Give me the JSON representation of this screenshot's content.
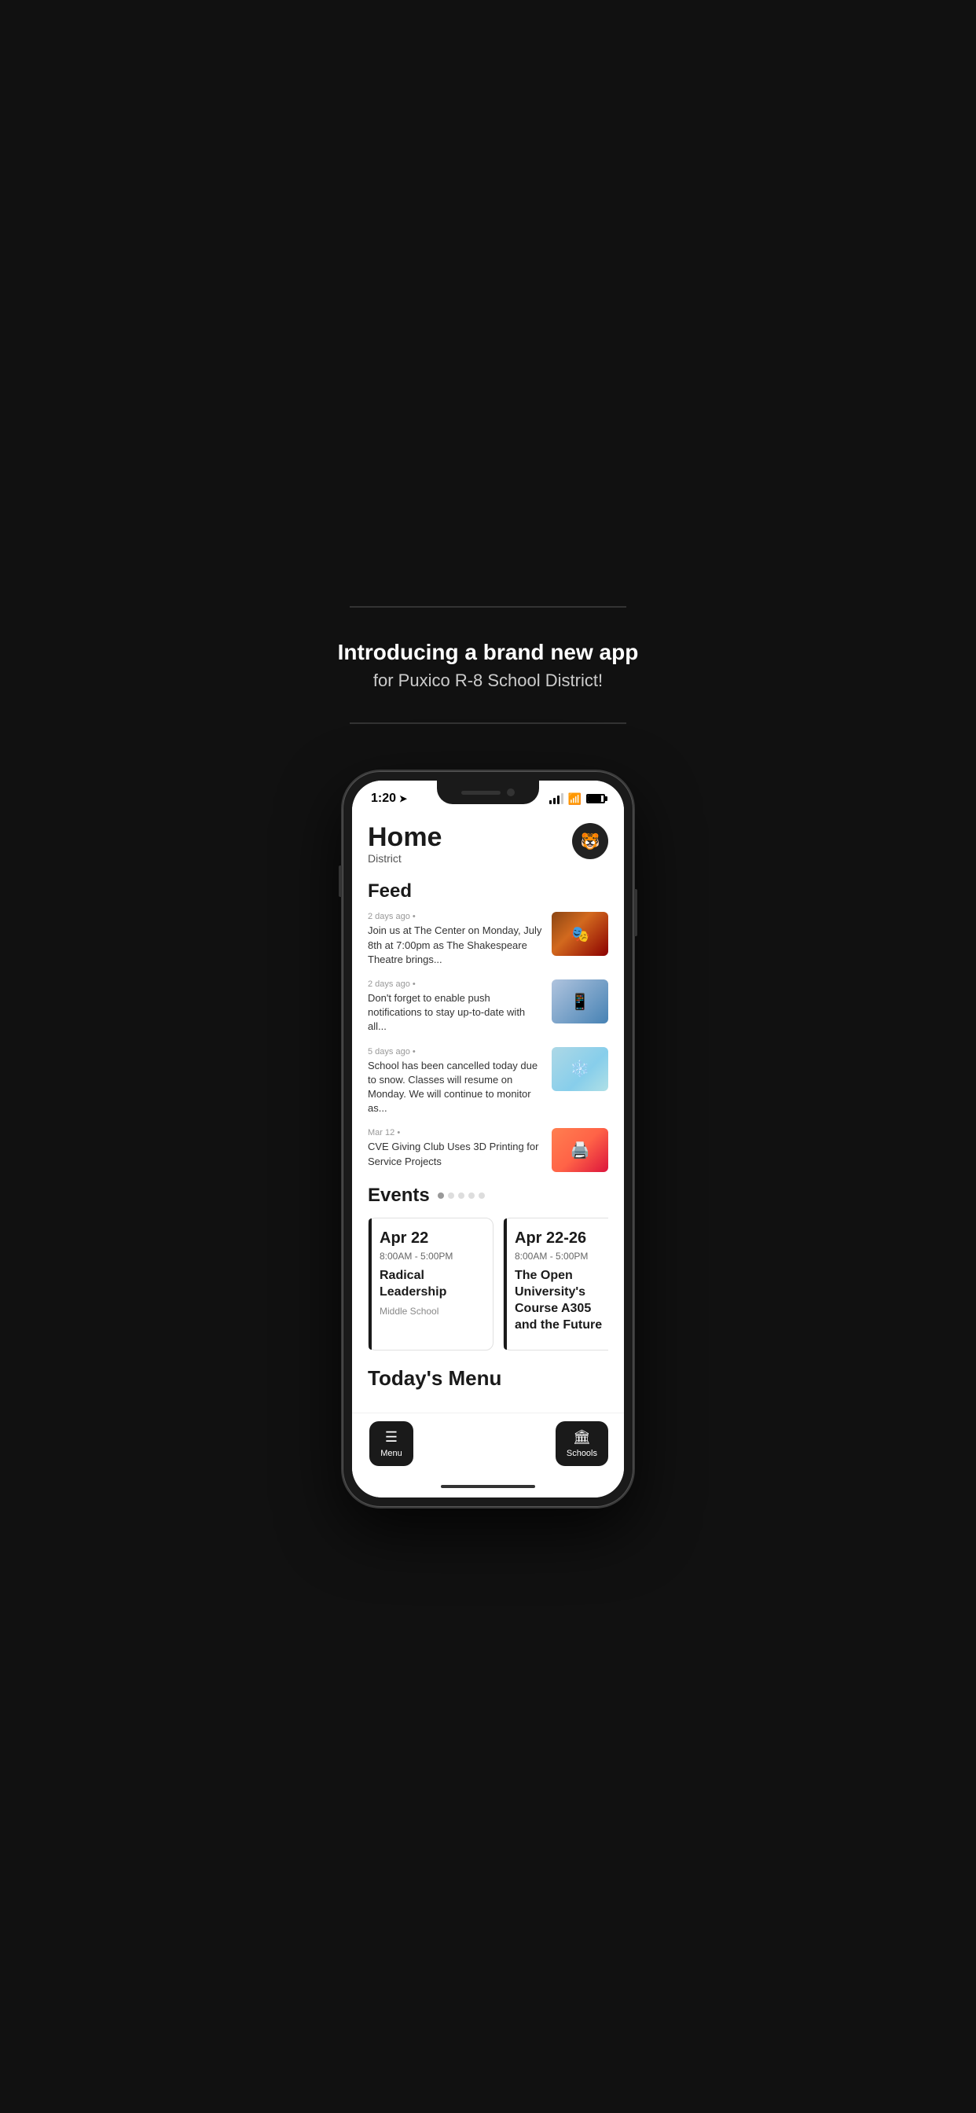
{
  "promo": {
    "divider": "",
    "title": "Introducing a brand new app",
    "subtitle": "for Puxico R-8 School District!",
    "divider_bottom": ""
  },
  "statusBar": {
    "time": "1:20",
    "hasLocation": true
  },
  "appHeader": {
    "title": "Home",
    "subtitle": "District",
    "avatarIcon": "🐯"
  },
  "feed": {
    "sectionTitle": "Feed",
    "items": [
      {
        "time": "2 days ago",
        "bullet": "•",
        "text": "Join us at The Center on Monday, July 8th at 7:00pm as The Shakespeare Theatre brings...",
        "thumbType": "theater"
      },
      {
        "time": "2 days ago",
        "bullet": "•",
        "text": "Don't forget to enable push notifications to stay up-to-date with all...",
        "thumbType": "phone"
      },
      {
        "time": "5 days ago",
        "bullet": "•",
        "text": "School has been cancelled today due to snow. Classes will resume on Monday. We will continue to monitor as...",
        "thumbType": "snow"
      },
      {
        "time": "Mar 12",
        "bullet": "•",
        "text": "CVE Giving Club Uses 3D Printing for Service Projects",
        "thumbType": "kids"
      }
    ]
  },
  "events": {
    "sectionTitle": "Events",
    "dots": 5,
    "activeDot": 0,
    "cards": [
      {
        "date": "Apr 22",
        "time": "8:00AM  -  5:00PM",
        "name": "Radical Leadership",
        "location": "Middle School"
      },
      {
        "date": "Apr 22-26",
        "time": "8:00AM  -  5:00PM",
        "name": "The Open University's Course A305 and the Future",
        "location": ""
      }
    ]
  },
  "menu": {
    "sectionTitle": "Today's Menu"
  },
  "tabBar": {
    "menuBtn": {
      "label": "Menu",
      "icon": "☰"
    },
    "schoolsBtn": {
      "label": "Schools",
      "icon": "🏛"
    }
  }
}
